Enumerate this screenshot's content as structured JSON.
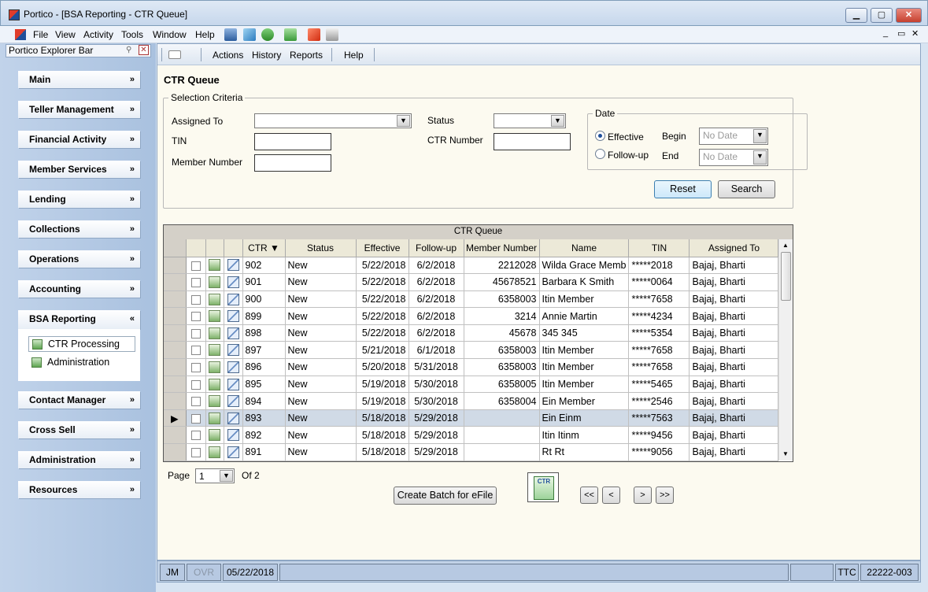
{
  "window": {
    "title": "Portico - [BSA Reporting - CTR Queue]",
    "min": "▁",
    "max": "▢",
    "close": "✕"
  },
  "menubar": {
    "items": [
      "File",
      "View",
      "Activity",
      "Tools",
      "Window",
      "Help"
    ],
    "restore": "▭",
    "close": "✕",
    "min": "_"
  },
  "explorer": {
    "title": "Portico Explorer Bar",
    "sections": [
      "Main",
      "Teller Management",
      "Financial Activity",
      "Member Services",
      "Lending",
      "Collections",
      "Operations",
      "Accounting",
      "BSA Reporting",
      "Contact Manager",
      "Cross Sell",
      "Administration",
      "Resources"
    ],
    "bsa_items": [
      "CTR Processing",
      "Administration"
    ],
    "chev_down": "»",
    "chev_up": "«"
  },
  "subtoolbar": {
    "items": [
      "Actions",
      "History",
      "Reports",
      "Help"
    ]
  },
  "page": {
    "title": "CTR Queue"
  },
  "criteria": {
    "legend": "Selection Criteria",
    "assigned_to_label": "Assigned To",
    "tin_label": "TIN",
    "member_number_label": "Member Number",
    "status_label": "Status",
    "ctr_number_label": "CTR Number",
    "date_legend": "Date",
    "effective_label": "Effective",
    "followup_label": "Follow-up",
    "begin_label": "Begin",
    "end_label": "End",
    "begin_value": "No Date",
    "end_value": "No Date",
    "reset_label": "Reset",
    "search_label": "Search"
  },
  "grid": {
    "title": "CTR Queue",
    "columns": [
      "CTR ▼",
      "Status",
      "Effective",
      "Follow-up",
      "Member Number",
      "Name",
      "TIN",
      "Assigned To"
    ],
    "rows": [
      {
        "ctr": "902",
        "status": "New",
        "effective": "5/22/2018",
        "followup": "6/2/2018",
        "member": "2212028",
        "name": "Wilda Grace Memb",
        "tin": "*****2018",
        "assigned": "Bajaj, Bharti"
      },
      {
        "ctr": "901",
        "status": "New",
        "effective": "5/22/2018",
        "followup": "6/2/2018",
        "member": "45678521",
        "name": "Barbara K Smith",
        "tin": "*****0064",
        "assigned": "Bajaj, Bharti"
      },
      {
        "ctr": "900",
        "status": "New",
        "effective": "5/22/2018",
        "followup": "6/2/2018",
        "member": "6358003",
        "name": "Itin Member",
        "tin": "*****7658",
        "assigned": "Bajaj, Bharti"
      },
      {
        "ctr": "899",
        "status": "New",
        "effective": "5/22/2018",
        "followup": "6/2/2018",
        "member": "3214",
        "name": "Annie Martin",
        "tin": "*****4234",
        "assigned": "Bajaj, Bharti"
      },
      {
        "ctr": "898",
        "status": "New",
        "effective": "5/22/2018",
        "followup": "6/2/2018",
        "member": "45678",
        "name": "345 345",
        "tin": "*****5354",
        "assigned": "Bajaj, Bharti"
      },
      {
        "ctr": "897",
        "status": "New",
        "effective": "5/21/2018",
        "followup": "6/1/2018",
        "member": "6358003",
        "name": "Itin Member",
        "tin": "*****7658",
        "assigned": "Bajaj, Bharti"
      },
      {
        "ctr": "896",
        "status": "New",
        "effective": "5/20/2018",
        "followup": "5/31/2018",
        "member": "6358003",
        "name": "Itin Member",
        "tin": "*****7658",
        "assigned": "Bajaj, Bharti"
      },
      {
        "ctr": "895",
        "status": "New",
        "effective": "5/19/2018",
        "followup": "5/30/2018",
        "member": "6358005",
        "name": "Itin Member",
        "tin": "*****5465",
        "assigned": "Bajaj, Bharti"
      },
      {
        "ctr": "894",
        "status": "New",
        "effective": "5/19/2018",
        "followup": "5/30/2018",
        "member": "6358004",
        "name": "Ein Member",
        "tin": "*****2546",
        "assigned": "Bajaj, Bharti"
      },
      {
        "ctr": "893",
        "status": "New",
        "effective": "5/18/2018",
        "followup": "5/29/2018",
        "member": "",
        "name": "Ein Einm",
        "tin": "*****7563",
        "assigned": "Bajaj, Bharti"
      },
      {
        "ctr": "892",
        "status": "New",
        "effective": "5/18/2018",
        "followup": "5/29/2018",
        "member": "",
        "name": "Itin Itinm",
        "tin": "*****9456",
        "assigned": "Bajaj, Bharti"
      },
      {
        "ctr": "891",
        "status": "New",
        "effective": "5/18/2018",
        "followup": "5/29/2018",
        "member": "",
        "name": "Rt Rt",
        "tin": "*****9056",
        "assigned": "Bajaj, Bharti"
      }
    ],
    "selected_ctr": "893",
    "row_pointer": "▶"
  },
  "pager": {
    "page_label": "Page",
    "page_value": "1",
    "of_label": "Of",
    "total": "2",
    "first": "<<",
    "prev": "<",
    "next": ">",
    "last": ">>"
  },
  "actions": {
    "batch_label": "Create Batch for eFile",
    "ctr_icon_text": "CTR"
  },
  "statusbar": {
    "user": "JM",
    "ovr": "OVR",
    "date": "05/22/2018",
    "ttc": "TTC",
    "code": "22222-003"
  }
}
